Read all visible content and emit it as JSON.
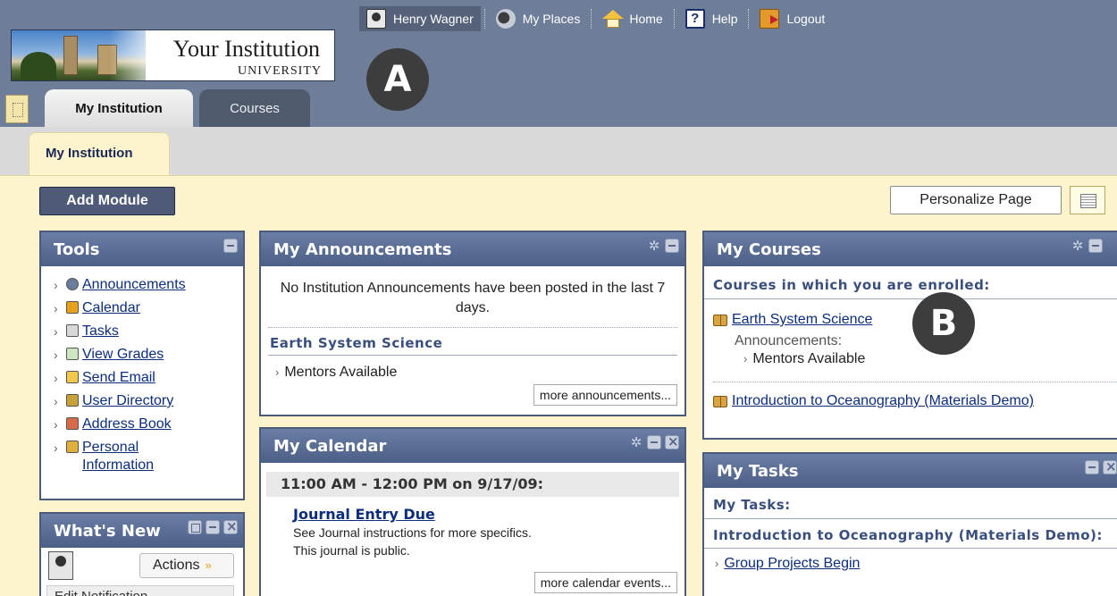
{
  "header": {
    "logo_name": "Your Institution",
    "logo_sub": "UNIVERSITY",
    "user_name": "Henry Wagner",
    "nav": {
      "my_places": "My Places",
      "home": "Home",
      "help": "Help",
      "logout": "Logout"
    },
    "tabs": {
      "my_institution": "My Institution",
      "courses": "Courses"
    },
    "badge_a": "A"
  },
  "page": {
    "subtab": "My Institution",
    "add_module": "Add Module",
    "personalize": "Personalize Page"
  },
  "tools": {
    "title": "Tools",
    "items": [
      {
        "label": "Announcements",
        "icon": "announcements-icon"
      },
      {
        "label": "Calendar",
        "icon": "calendar-icon"
      },
      {
        "label": "Tasks",
        "icon": "tasks-icon"
      },
      {
        "label": "View Grades",
        "icon": "grades-icon"
      },
      {
        "label": "Send Email",
        "icon": "email-icon"
      },
      {
        "label": "User Directory",
        "icon": "user-directory-icon"
      },
      {
        "label": "Address Book",
        "icon": "address-book-icon"
      },
      {
        "label": "Personal Information",
        "icon": "personal-info-icon"
      }
    ]
  },
  "whats_new": {
    "title": "What's New",
    "actions": "Actions",
    "edit": "Edit Notification"
  },
  "announcements": {
    "title": "My Announcements",
    "empty": "No Institution Announcements have been posted in the last 7 days.",
    "course": "Earth System Science",
    "item": "Mentors Available",
    "more": "more announcements..."
  },
  "calendar": {
    "title": "My Calendar",
    "time": "11:00 AM - 12:00 PM on 9/17/09:",
    "event": "Journal Entry Due",
    "desc1": "See Journal instructions for more specifics.",
    "desc2": "This journal is public.",
    "more": "more calendar events..."
  },
  "courses": {
    "title": "My Courses",
    "heading": "Courses in which you are enrolled:",
    "course1": "Earth System Science",
    "ann_label": "Announcements:",
    "ann_item": "Mentors Available",
    "course2": "Introduction to Oceanography (Materials Demo)",
    "badge_b": "B"
  },
  "tasks": {
    "title": "My Tasks",
    "heading": "My Tasks:",
    "course": "Introduction to Oceanography (Materials Demo):",
    "item": "Group Projects Begin"
  },
  "colors": {
    "header_bg": "#6e7e98",
    "module_head": "#4c5f86",
    "content_bg": "#fdf3cd",
    "link": "#0b2d7a"
  }
}
